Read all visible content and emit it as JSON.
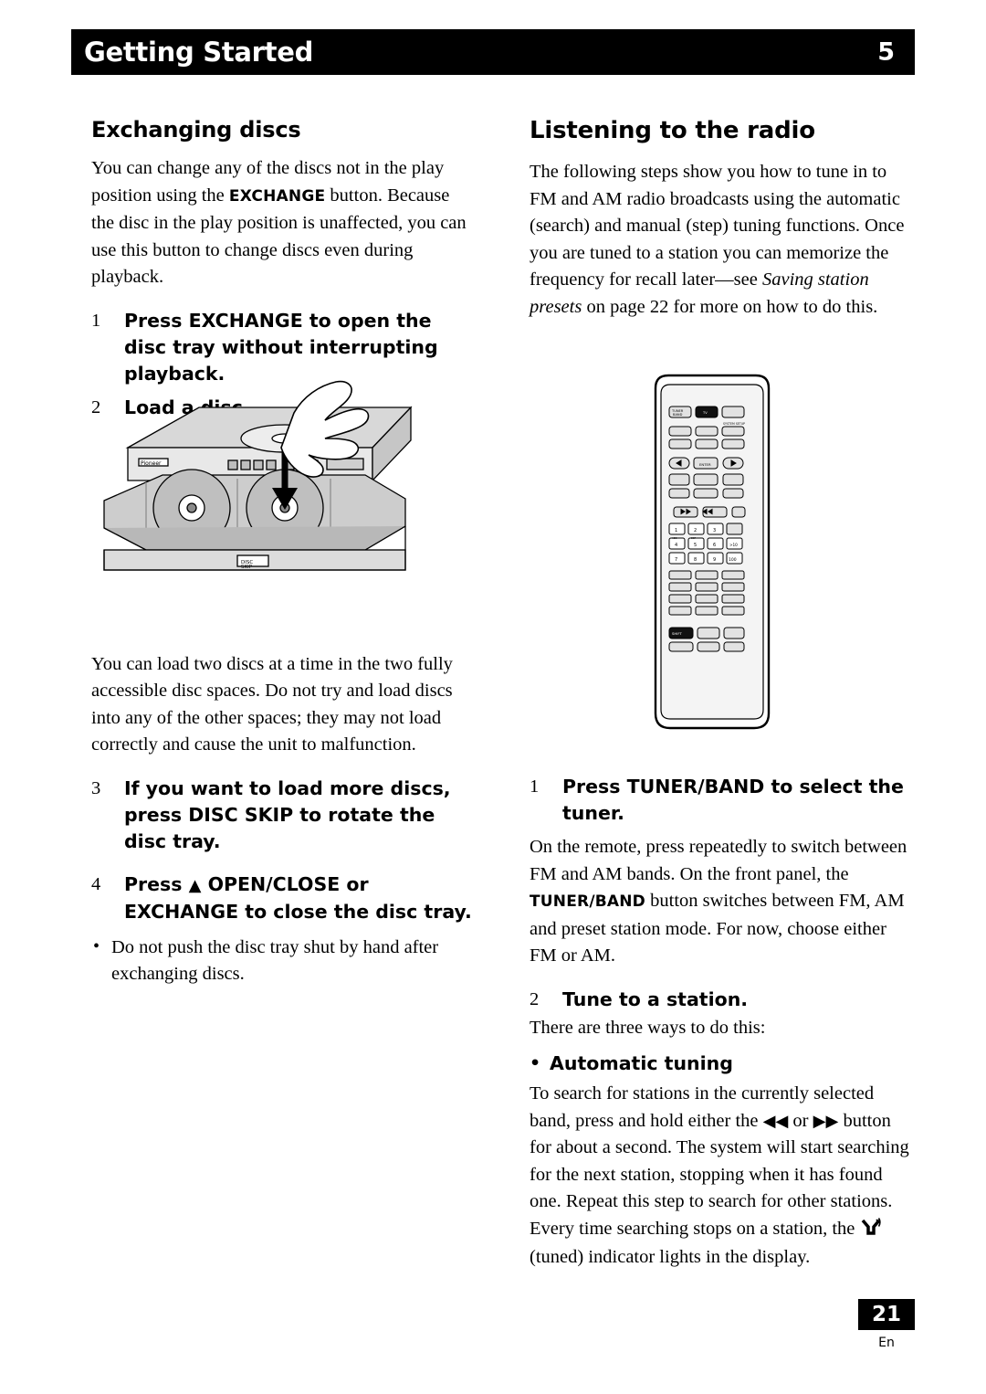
{
  "header": {
    "title": "Getting Started",
    "chapter_number": "5"
  },
  "footer": {
    "page_number": "21",
    "language_code": "En"
  },
  "left_column": {
    "heading": "Exchanging discs",
    "intro_p1": "You can change any of the discs not in the play position using the ",
    "intro_exchange": "EXCHANGE",
    "intro_p2": " button. Because the disc in the play position is unaffected, you can use this button to change discs even during playback.",
    "steps": [
      {
        "num": "1",
        "text": "Press EXCHANGE to open the disc tray without interrupting playback."
      },
      {
        "num": "2",
        "text": "Load a disc."
      }
    ],
    "figure_caption": "You can load two discs at a time in the two fully accessible disc spaces. Do not try and load discs into any of the other spaces; they may not load correctly and cause the unit to malfunction.",
    "steps2": [
      {
        "num": "3",
        "text": "If you want to load more discs, press DISC SKIP to rotate the disc tray."
      },
      {
        "num": "4",
        "text_before": "Press ",
        "eject_icon": "▲",
        "text_after": " OPEN/CLOSE or EXCHANGE to close the disc tray."
      }
    ],
    "bullet": "Do not push the disc tray shut by hand after exchanging discs.",
    "figure_labels": {
      "brand": "Pioneer",
      "disc_tray_label": "DISC\nSKIP"
    }
  },
  "right_column": {
    "heading": "Listening to the radio",
    "intro_a": "The following steps show you how to tune in to FM and AM radio broadcasts using the automatic (search) and manual (step) tuning functions. Once you are tuned to a station you can memorize the frequency for recall later—see ",
    "intro_italic": "Saving station presets",
    "intro_b": " on page 22 for more on how to do this.",
    "step1_label": "1",
    "step1": "Press TUNER/BAND to select the tuner.",
    "step1_body_a": "On the remote, press repeatedly to switch between FM and AM bands. On the front panel, the ",
    "step1_tuner_band": "TUNER/BAND",
    "step1_body_b": " button switches between FM, AM and preset station mode. For now, choose either FM or AM.",
    "step2_label": "2",
    "step2": "Tune to a station.",
    "step2_body": "There are three ways to do this:",
    "bullet_auto": "Automatic tuning",
    "auto_a": "To search for stations in the currently selected band, press and hold either the ",
    "auto_icon_back": "◀◀",
    "auto_mid": " or ",
    "auto_icon_fwd": "▶▶",
    "auto_b": " button for about a second. The system will start searching for the next station, stopping when it has found one. Repeat this step to search for other stations. Every time searching stops on a station, the ",
    "auto_tuned_icon": "tuned-indicator-icon",
    "auto_c": "(tuned) indicator lights in the display."
  },
  "remote_figure": {
    "name": "remote-control-illustration",
    "button_labels": {
      "tuner_band": "TUNER\nBAND",
      "tv": "TV",
      "system_setup": "SYSTEM SETUP",
      "enter": "ENTER",
      "shift": "SHIFT",
      "num_1": "1",
      "num_2": "2",
      "num_3": "3",
      "num_4": "4",
      "num_5": "5",
      "num_6": "6",
      "num_7": "7",
      "num_8": "8",
      "num_9": "9",
      "num_10": "100",
      "num_over10": ">10"
    }
  }
}
